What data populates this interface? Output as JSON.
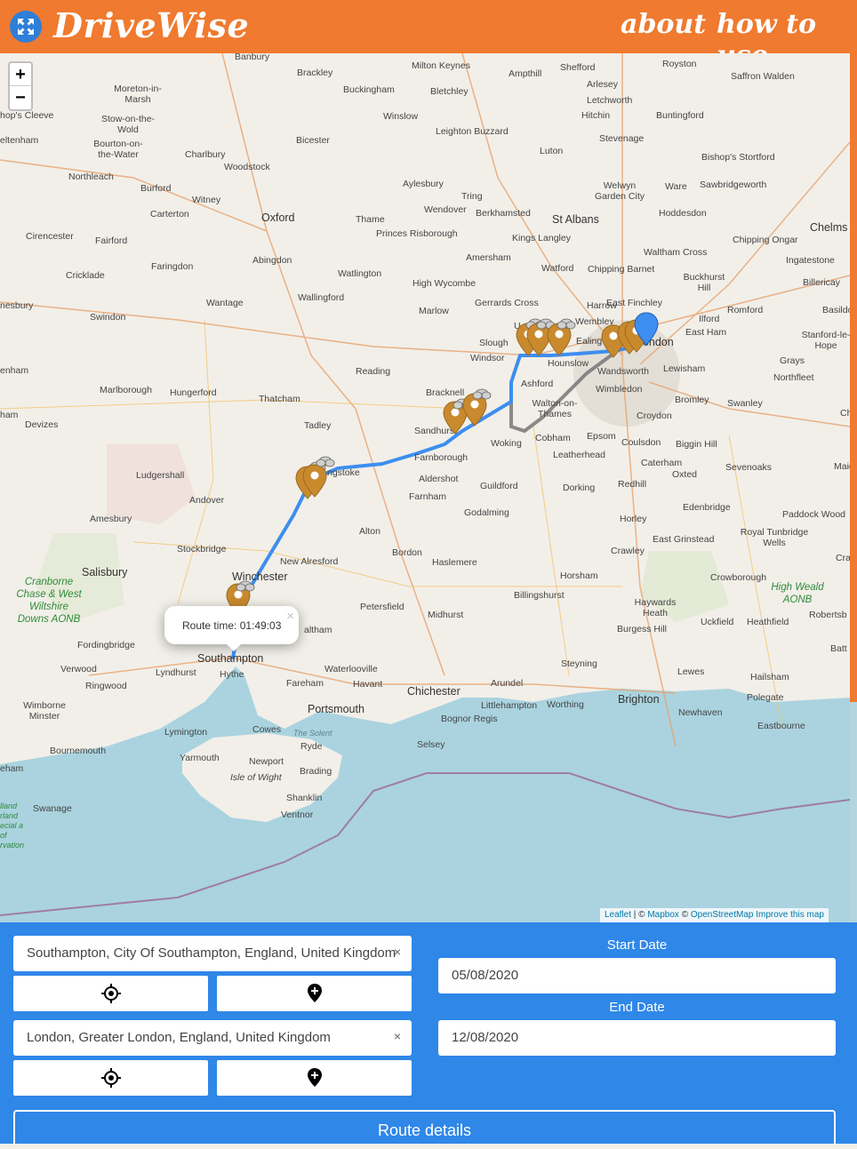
{
  "header": {
    "brand": "DriveWise",
    "nav_about": "about",
    "nav_how": "how to use"
  },
  "map": {
    "zoom_in": "+",
    "zoom_out": "−",
    "places": {
      "banbury": "Banbury",
      "brackley": "Brackley",
      "milton_keynes": "Milton Keynes",
      "ampthill": "Ampthill",
      "shefford": "Shefford",
      "royston": "Royston",
      "saffron_walden": "Saffron Walden",
      "moreton": "Moreton-in-Marsh",
      "buckingham": "Buckingham",
      "bletchley": "Bletchley",
      "arlesey": "Arlesey",
      "letchworth": "Letchworth",
      "bishops_cleeve": "hop's Cleeve",
      "stow": "Stow-on-the-Wold",
      "winslow": "Winslow",
      "hitchin": "Hitchin",
      "buntingford": "Buntingford",
      "cheltenham": "eltenham",
      "bourton": "Bourton-on-the-Water",
      "leighton": "Leighton Buzzard",
      "stevenage": "Stevenage",
      "bicester": "Bicester",
      "luton": "Luton",
      "charlbury": "Charlbury",
      "bishops_stortford": "Bishop's Stortford",
      "northleach": "Northleach",
      "woodstock": "Woodstock",
      "aylesbury": "Aylesbury",
      "welwyn": "Welwyn Garden City",
      "ware": "Ware",
      "sawbridgeworth": "Sawbridgeworth",
      "burford": "Burford",
      "tring": "Tring",
      "witney": "Witney",
      "carterton": "Carterton",
      "wendover": "Wendover",
      "berkhamsted": "Berkhamsted",
      "hoddesdon": "Hoddesdon",
      "oxford": "Oxford",
      "thame": "Thame",
      "st_albans": "St Albans",
      "chelmsford": "Chelms",
      "cirencester": "Cirencester",
      "fairford": "Fairford",
      "princes": "Princes Risborough",
      "kings_langley": "Kings Langley",
      "chipping_ongar": "Chipping Ongar",
      "abingdon": "Abingdon",
      "faringdon": "Faringdon",
      "amersham": "Amersham",
      "waltham_cross": "Waltham Cross",
      "ingatestone": "Ingatestone",
      "watford": "Watford",
      "chipping_barnet": "Chipping Barnet",
      "watlington": "Watlington",
      "cricklade": "Cricklade",
      "buckhurst": "Buckhurst Hill",
      "high_wycombe": "High Wycombe",
      "billericay": "Billericay",
      "wantage": "Wantage",
      "wallingford": "Wallingford",
      "gerrards": "Gerrards Cross",
      "harrow": "Harrow",
      "east_finchley": "East Finchley",
      "nesbury": "nesbury",
      "marlow": "Marlow",
      "romford": "Romford",
      "basildon": "Basildo",
      "swindon": "Swindon",
      "wembley": "Wembley",
      "ilford": "Ilford",
      "uxbridge": "U",
      "slough": "Slough",
      "ealing": "Ealing",
      "london": "London",
      "east_ham": "East Ham",
      "stanford": "Stanford-le-Hope",
      "windsor": "Windsor",
      "hounslow": "Hounslow",
      "lewisham": "Lewisham",
      "grays": "Grays",
      "reading": "Reading",
      "wandsworth": "Wandsworth",
      "northfleet": "Northfleet",
      "ham": "enham",
      "marlborough": "Marlborough",
      "hungerford": "Hungerford",
      "ashford": "Ashford",
      "wimbledon": "Wimbledon",
      "bromley": "Bromley",
      "swanley": "Swanley",
      "thatcham": "Thatcham",
      "bracknell": "Bracknell",
      "walton": "Walton-on-Thames",
      "croydon": "Croydon",
      "ham2": "ham",
      "devizes": "Devizes",
      "tadley": "Tadley",
      "sandhurst": "Sandhurst",
      "cobham": "Cobham",
      "epsom": "Epsom",
      "chat": "Ch",
      "woking": "Woking",
      "coulsdon": "Coulsdon",
      "biggin": "Biggin Hill",
      "leatherhead": "Leatherhead",
      "farnborough": "Farnborough",
      "sevenoaks": "Sevenoaks",
      "caterham": "Caterham",
      "maid": "Maid",
      "ludgershall": "Ludgershall",
      "basingstoke": "ngstoke",
      "aldershot": "Aldershot",
      "oxted": "Oxted",
      "guildford": "Guildford",
      "dorking": "Dorking",
      "redhill": "Redhill",
      "andover": "Andover",
      "farnham": "Farnham",
      "godalming": "Godalming",
      "edenbridge": "Edenbridge",
      "paddock": "Paddock Wood",
      "amesbury": "Amesbury",
      "horley": "Horley",
      "alton": "Alton",
      "east_grinstead": "East Grinstead",
      "royal_tunbridge": "Royal Tunbridge Wells",
      "stockbridge": "Stockbridge",
      "crawley": "Crawley",
      "bordon": "Bordon",
      "cra": "Cra",
      "new_alresford": "New Alresford",
      "haslemere": "Haslemere",
      "salisbury": "Salisbury",
      "winchester": "Winchester",
      "horsham": "Horsham",
      "crowborough": "Crowborough",
      "cranborne": "Cranborne Chase & West Wiltshire Downs AONB",
      "high_weald": "High Weald AONB",
      "billingshurst": "Billingshurst",
      "petersfield": "Petersfield",
      "haywards": "Haywards Heath",
      "robertsbridge": "Robertsb",
      "midhurst": "Midhurst",
      "uckfield": "Uckfield",
      "heathfield": "Heathfield",
      "bishops_waltham": "altham",
      "fordingbridge": "Fordingbridge",
      "burgess": "Burgess Hill",
      "batt": "Batt",
      "southampton": "Southampton",
      "steyning": "Steyning",
      "verwood": "Verwood",
      "lyndhurst": "Lyndhurst",
      "waterlooville": "Waterlooville",
      "hythe": "Hythe",
      "lewes": "Lewes",
      "hailsham": "Hailsham",
      "ringwood": "Ringwood",
      "fareham": "Fareham",
      "havant": "Havant",
      "chichester": "Chichester",
      "arundel": "Arundel",
      "polegate": "Polegate",
      "wimborne": "Wimborne Minster",
      "littlehampton": "Littlehampton",
      "worthing": "Worthing",
      "brighton": "Brighton",
      "portsmouth": "Portsmouth",
      "bognor": "Bognor Regis",
      "newhaven": "Newhaven",
      "lymington": "Lymington",
      "cowes": "Cowes",
      "the_solent": "The Solent",
      "eastbourne": "Eastbourne",
      "bournemouth": "Bournemouth",
      "ryde": "Ryde",
      "selsey": "Selsey",
      "yarmouth": "Yarmouth",
      "newport": "Newport",
      "ham3": "eham",
      "brading": "Brading",
      "isle_of_wight": "Isle of Wight",
      "shanklin": "Shanklin",
      "swanage": "Swanage",
      "ventnor": "Ventnor",
      "dorset_aonb": "lland rland ecial a of rvation"
    },
    "popup_text": "Route time: 01:49:03",
    "popup_close": "×",
    "attribution": {
      "leaflet": "Leaflet",
      "sep": " | © ",
      "mapbox": "Mapbox",
      "sep2": " © ",
      "osm": "OpenStreetMap",
      "improve": "Improve this map"
    },
    "colors": {
      "route_primary": "#3d8ef0",
      "route_alt": "#777777",
      "marker": "#c98a2e",
      "sea": "#aad3df",
      "land": "#f2efe9"
    }
  },
  "form": {
    "origin_value": "Southampton, City Of Southampton, England, United Kingdom",
    "destination_value": "London, Greater London, England, United Kingdom",
    "clear": "×",
    "locate_icon": "crosshair-icon",
    "pin_icon": "map-pin-plus-icon",
    "start_date_label": "Start Date",
    "start_date_value": "05/08/2020",
    "end_date_label": "End Date",
    "end_date_value": "12/08/2020",
    "route_details_label": "Route details"
  }
}
